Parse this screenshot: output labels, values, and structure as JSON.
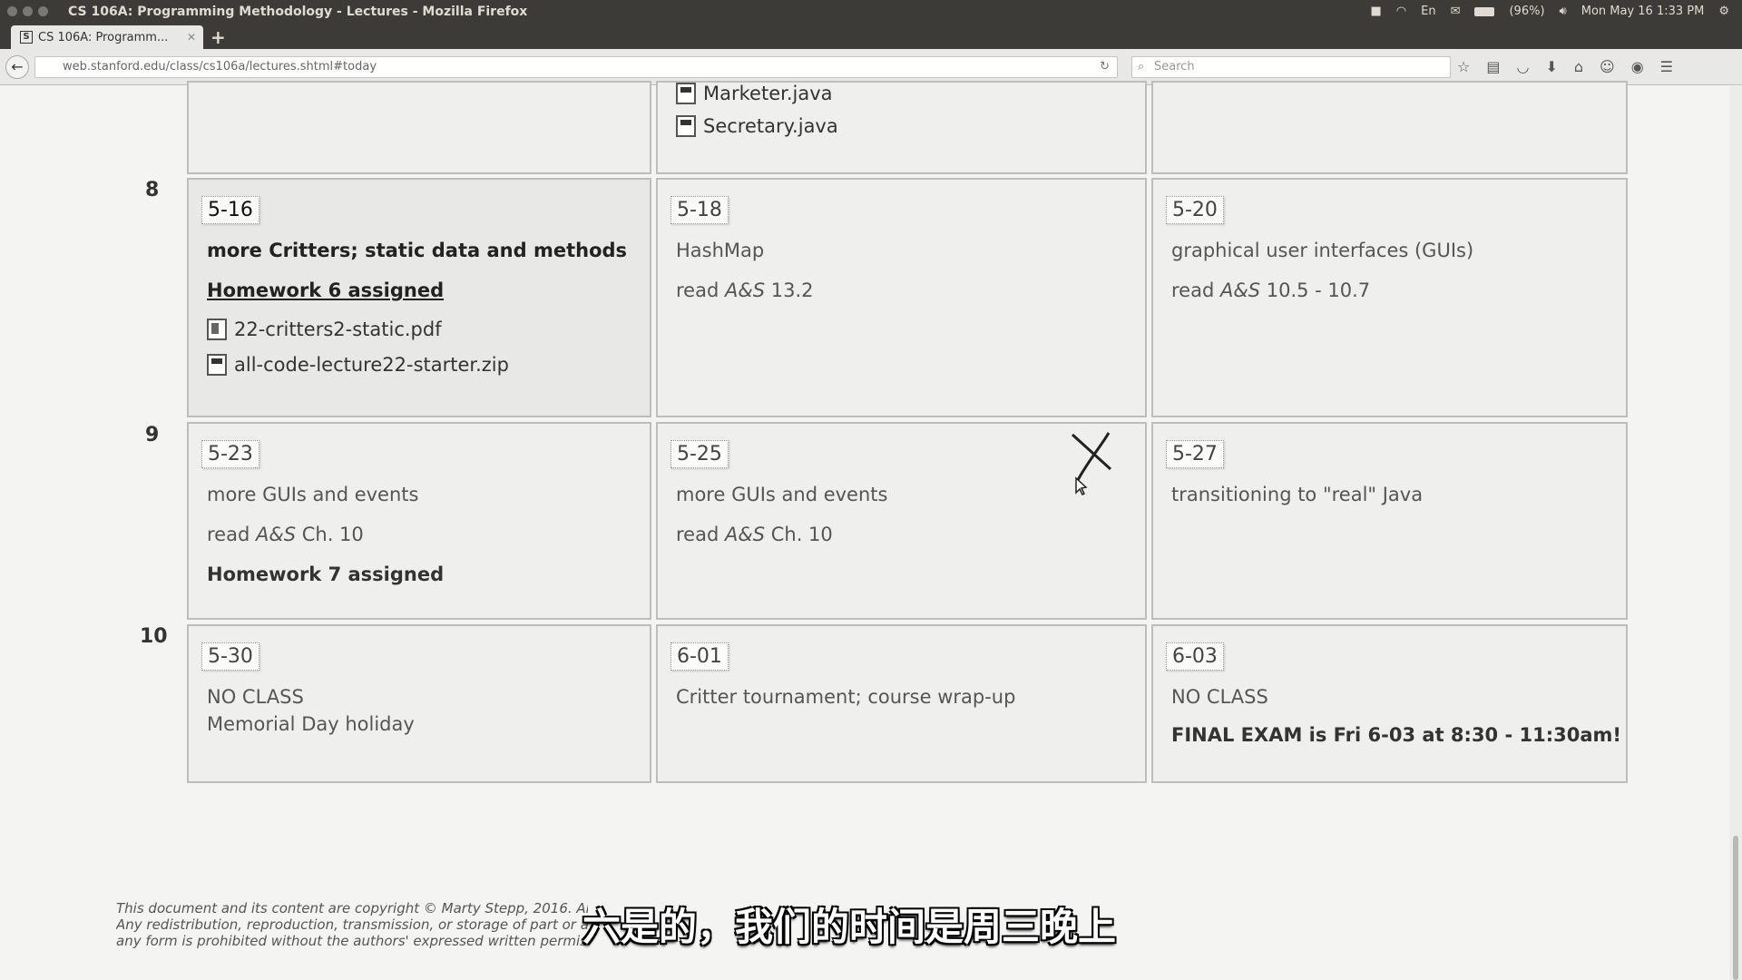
{
  "window": {
    "title": "CS 106A: Programming Methodology - Lectures - Mozilla Firefox",
    "tray": {
      "battery": "(96%)",
      "clock": "Mon May 16  1:33 PM",
      "lang": "En"
    }
  },
  "browser": {
    "tab_title": "CS 106A: Programm...",
    "url": "web.stanford.edu/class/cs106a/lectures.shtml#today",
    "search_placeholder": "Search"
  },
  "schedule": {
    "top_files": [
      "Marketer.java",
      "Secretary.java"
    ],
    "weeks": [
      {
        "number": "8",
        "days": [
          {
            "date": "5-16",
            "topic": "more Critters; static data and methods",
            "homework": "Homework 6 assigned",
            "files": [
              "22-critters2-static.pdf",
              "all-code-lecture22-starter.zip"
            ]
          },
          {
            "date": "5-18",
            "topic": "HashMap",
            "reading_prefix": "read ",
            "reading_book": "A&S",
            "reading_suffix": " 13.2"
          },
          {
            "date": "5-20",
            "topic": "graphical user interfaces (GUIs)",
            "reading_prefix": "read ",
            "reading_book": "A&S",
            "reading_suffix": " 10.5 - 10.7"
          }
        ]
      },
      {
        "number": "9",
        "days": [
          {
            "date": "5-23",
            "topic": "more GUIs and events",
            "reading_prefix": "read ",
            "reading_book": "A&S",
            "reading_suffix": " Ch. 10",
            "homework": "Homework 7 assigned"
          },
          {
            "date": "5-25",
            "topic": "more GUIs and events",
            "reading_prefix": "read ",
            "reading_book": "A&S",
            "reading_suffix": " Ch. 10"
          },
          {
            "date": "5-27",
            "topic": "transitioning to \"real\" Java"
          }
        ]
      },
      {
        "number": "10",
        "days": [
          {
            "date": "5-30",
            "topic": "NO CLASS",
            "note": "Memorial Day holiday"
          },
          {
            "date": "6-01",
            "topic": "Critter tournament; course wrap-up"
          },
          {
            "date": "6-03",
            "topic": "NO CLASS",
            "note": "FINAL EXAM is Fri 6-03 at 8:30 - 11:30am!"
          }
        ]
      }
    ]
  },
  "footer": {
    "line1": "This document and its content are copyright © Marty Stepp, 2016. All ri",
    "line2": "Any redistribution, reproduction, transmission, or storage of part or all o",
    "line3": "any form is prohibited without the authors' expressed written permissio"
  },
  "subtitle": "六是的，我们的时间是周三晚上"
}
